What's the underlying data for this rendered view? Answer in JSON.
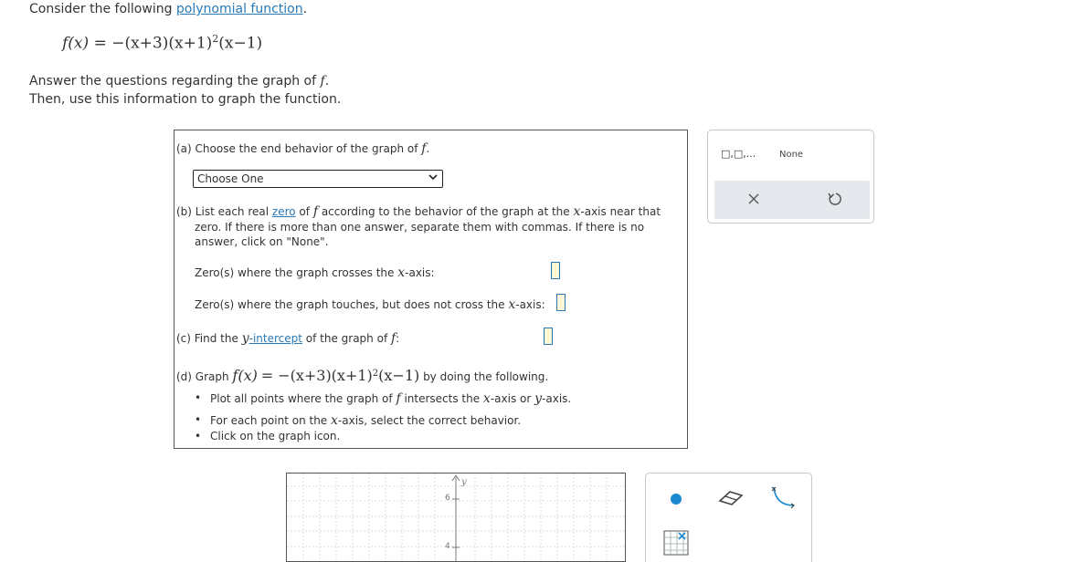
{
  "intro": {
    "prefix": "Consider the following ",
    "link": "polynomial function",
    "suffix": "."
  },
  "formula": {
    "lhs": "f(x)",
    "rhs": "= −(x+3)(x+1)",
    "exp": "2",
    "tail": "(x−1)"
  },
  "instructions": {
    "line1_prefix": "Answer the questions regarding the graph of ",
    "line1_var": "f",
    "line1_suffix": ".",
    "line2": "Then, use this information to graph the function."
  },
  "part_a": {
    "prefix": "(a) Choose the end behavior of the graph of ",
    "var": "f",
    "suffix": ".",
    "select_value": "Choose One"
  },
  "part_b": {
    "prefix": "(b) List each real ",
    "link": "zero",
    "mid1": " of ",
    "var": "f",
    "mid2": " according to the behavior of the graph at the ",
    "xvar": "x",
    "suffix": "-axis near that",
    "line2": "zero. If there is more than one answer, separate them with commas. If there is no",
    "line3": "answer, click on \"None\".",
    "crosses_prefix": "Zero(s) where the graph crosses the ",
    "crosses_var": "x",
    "crosses_suffix": "-axis:",
    "touches_prefix": "Zero(s) where the graph touches, but does not cross the ",
    "touches_var": "x",
    "touches_suffix": "-axis:"
  },
  "part_c": {
    "prefix": "(c) Find the ",
    "yvar": "y",
    "link": "-intercept",
    "mid": " of the graph of ",
    "var": "f",
    "suffix": ":"
  },
  "part_d": {
    "prefix": "(d) Graph ",
    "lhs": "f(x)",
    "rhs": "= −(x+3)(x+1)",
    "exp": "2",
    "tail": "(x−1)",
    "suffix": " by doing the following.",
    "bullets": [
      {
        "prefix": "Plot all points where the graph of ",
        "var": "f",
        "mid": " intersects the ",
        "v1": "x",
        "mid2": "-axis or ",
        "v2": "y",
        "suffix": "-axis."
      },
      {
        "prefix": "For each point on the ",
        "var": "x",
        "suffix": "-axis, select the correct behavior."
      },
      {
        "text": "Click on the graph icon."
      }
    ]
  },
  "tools_top": {
    "interval_label": "□,□,...",
    "none_label": "None"
  },
  "graph": {
    "y_axis_label": "y",
    "y_ticks": [
      "6",
      "4"
    ]
  }
}
